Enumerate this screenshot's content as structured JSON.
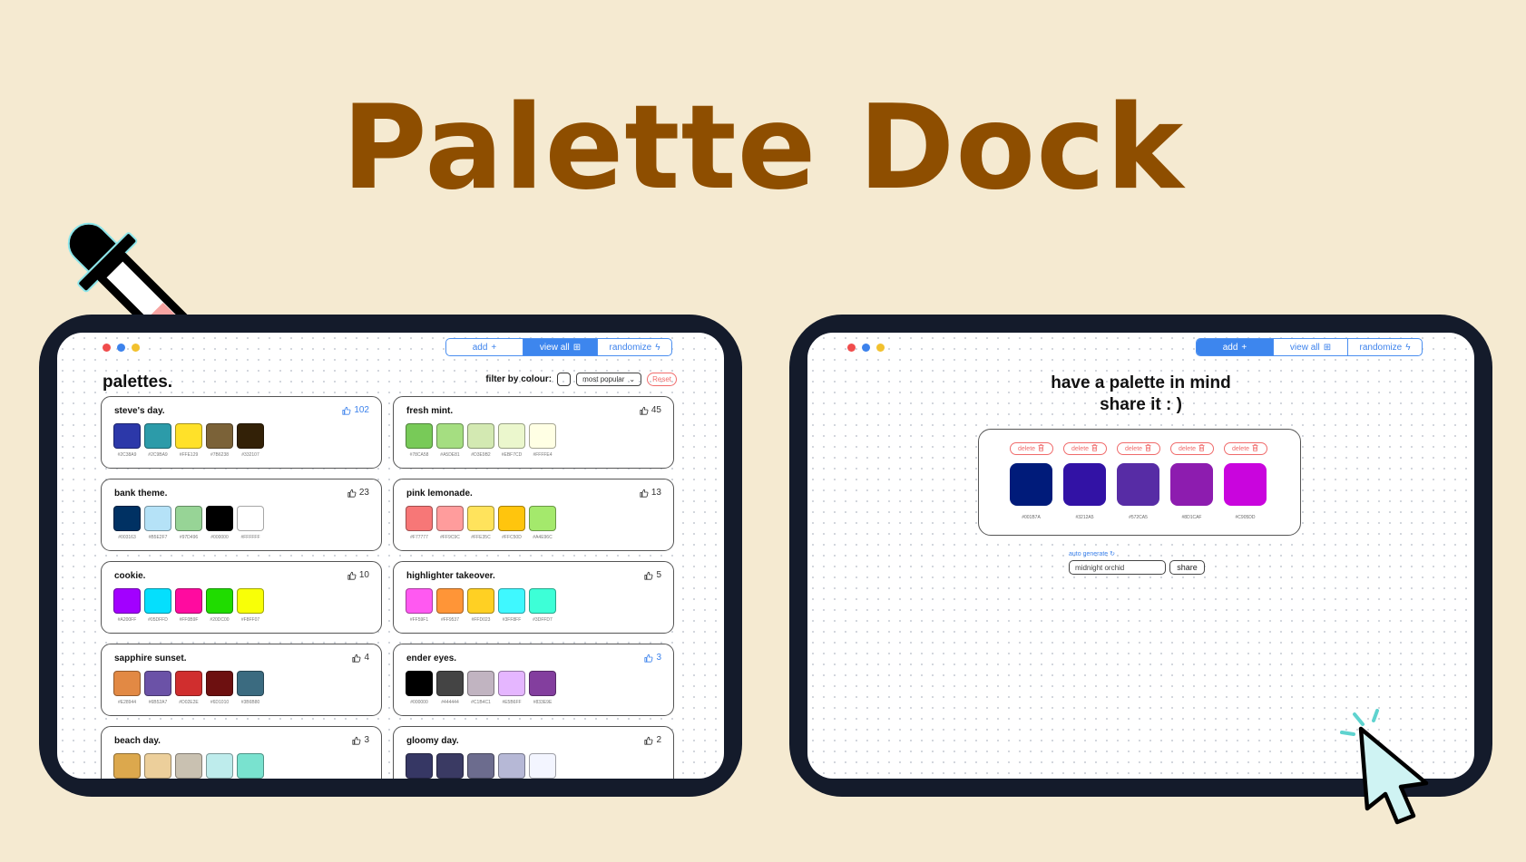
{
  "hero": {
    "title": "Palette Dock"
  },
  "window_dots": [
    "#f04c4c",
    "#3c82ec",
    "#f2c12e"
  ],
  "nav": {
    "add": "add",
    "view_all": "view all",
    "randomize": "randomize"
  },
  "left_screen": {
    "heading": "palettes.",
    "filter_label": "filter by colour:",
    "sort_value": "most popular",
    "reset_label": "Reset",
    "palettes": [
      {
        "name": "steve's day.",
        "likes": "102",
        "liked": true,
        "colors": [
          "#2C38A9",
          "#2C9BA9",
          "#FFE129",
          "#7B6238",
          "#332107"
        ]
      },
      {
        "name": "fresh mint.",
        "likes": "45",
        "liked": false,
        "colors": [
          "#78CA58",
          "#A5DE81",
          "#D3E9B2",
          "#EBF7CD",
          "#FFFFE4"
        ]
      },
      {
        "name": "bank theme.",
        "likes": "23",
        "liked": false,
        "colors": [
          "#003163",
          "#B5E2F7",
          "#97D496",
          "#000000",
          "#FFFFFF"
        ]
      },
      {
        "name": "pink lemonade.",
        "likes": "13",
        "liked": false,
        "colors": [
          "#F77777",
          "#FF9C9C",
          "#FFE35C",
          "#FFC50D",
          "#A4E96C"
        ]
      },
      {
        "name": "cookie.",
        "likes": "10",
        "liked": false,
        "colors": [
          "#A200FF",
          "#05DFFD",
          "#FF0B9F",
          "#20DC00",
          "#F8FF07"
        ]
      },
      {
        "name": "highlighter takeover.",
        "likes": "5",
        "liked": false,
        "colors": [
          "#FF59F1",
          "#FF9537",
          "#FFD023",
          "#3FF8FF",
          "#3DFFD7"
        ]
      },
      {
        "name": "sapphire sunset.",
        "likes": "4",
        "liked": false,
        "colors": [
          "#E28944",
          "#6B52A7",
          "#D02E2E",
          "#6D1010",
          "#3B6B80"
        ]
      },
      {
        "name": "ender eyes.",
        "likes": "3",
        "liked": true,
        "colors": [
          "#000000",
          "#444444",
          "#C1B4C1",
          "#E5B6FF",
          "#833E9E"
        ]
      },
      {
        "name": "beach day.",
        "likes": "3",
        "liked": false,
        "colors": [
          "#DCA84D",
          "#ECCF9B",
          "#C9C1B1",
          "#BEECEC",
          "#79E2CF"
        ]
      },
      {
        "name": "gloomy day.",
        "likes": "2",
        "liked": false,
        "colors": [
          "#363764",
          "#3A3A63",
          "#6C6C8E",
          "#B6B8D6",
          "#F3F5FF"
        ]
      }
    ]
  },
  "right_screen": {
    "heading_line1": "have a palette in mind",
    "heading_line2": "share it : )",
    "delete_label": "delete",
    "colors": [
      "#001B7A",
      "#3212A5",
      "#572CA5",
      "#8D1CAF",
      "#C905DD"
    ],
    "auto_generate": "auto generate",
    "name_value": "midnight orchid",
    "share_label": "share"
  },
  "colors": {
    "background": "#f5ead1",
    "title": "#8e4e00",
    "device": "#141b2b",
    "accent": "#3c82ec",
    "danger": "#f06b6b"
  }
}
